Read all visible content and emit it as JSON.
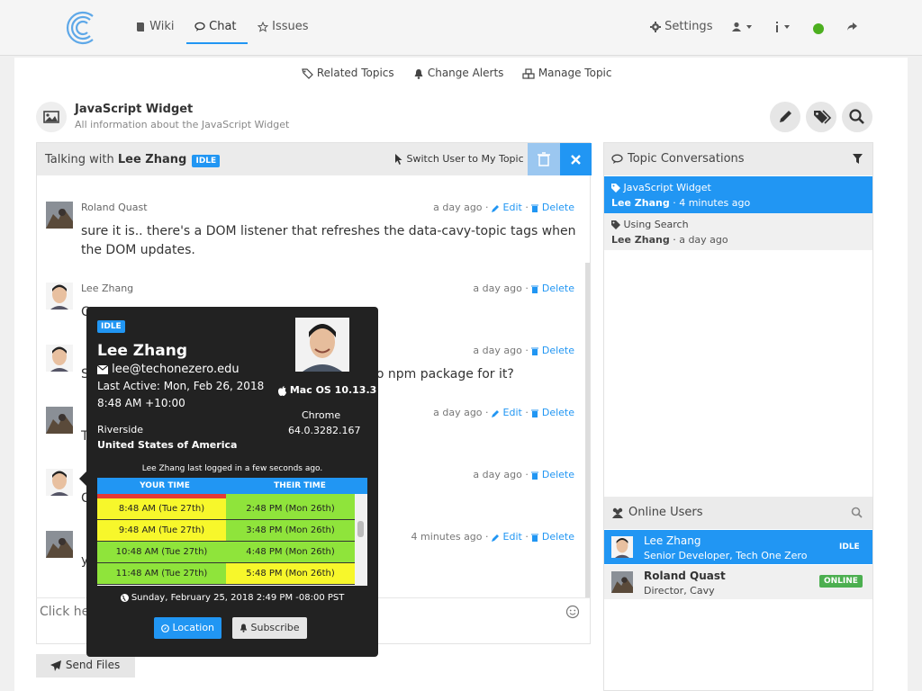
{
  "nav": {
    "wiki": "Wiki",
    "chat": "Chat",
    "issues": "Issues",
    "settings": "Settings"
  },
  "subnav": {
    "related_topics": "Related Topics",
    "change_alerts": "Change Alerts",
    "manage_topic": "Manage Topic"
  },
  "topic": {
    "title": "JavaScript Widget",
    "subtitle": "All information about the JavaScript Widget"
  },
  "chat": {
    "talking_prefix": "Talking with",
    "talking_user": "Lee Zhang",
    "status": "IDLE",
    "switch_label": "Switch User to My Topic",
    "composer_placeholder": "Click here to chat...",
    "send_files": "Send Files",
    "edit_label": "Edit",
    "delete_label": "Delete",
    "messages": [
      {
        "author": "Roland Quast",
        "time": "a day ago",
        "text": "sure it is.. there's a DOM listener that refreshes the data-cavy-topic tags when the DOM updates."
      },
      {
        "author": "Lee Zhang",
        "time": "a day ago",
        "text": "C"
      },
      {
        "author": "Lee Zhang",
        "time": "a day ago",
        "text": "S",
        "text_right": "no npm package for it?"
      },
      {
        "author": "Roland Quast",
        "time": "a day ago",
        "text": "T"
      },
      {
        "author": "Lee Zhang",
        "time": "a day ago",
        "text": "C"
      },
      {
        "author": "Roland Quast",
        "time": "4 minutes ago",
        "text": "y"
      }
    ]
  },
  "conversations": {
    "title": "Topic Conversations",
    "items": [
      {
        "topic": "JavaScript Widget",
        "user": "Lee Zhang",
        "time": "4 minutes ago"
      },
      {
        "topic": "Using Search",
        "user": "Lee Zhang",
        "time": "a day ago"
      }
    ]
  },
  "online": {
    "title": "Online Users",
    "users": [
      {
        "name": "Lee Zhang",
        "role": "Senior Developer, Tech One Zero",
        "status": "IDLE"
      },
      {
        "name": "Roland Quast",
        "role": "Director, Cavy",
        "status": "ONLINE"
      }
    ]
  },
  "profile": {
    "status": "IDLE",
    "name": "Lee Zhang",
    "email": "lee@techonezero.edu",
    "last_active_1": "Last Active: Mon, Feb 26, 2018",
    "last_active_2": "8:48 AM +10:00",
    "os": "Mac OS 10.13.3",
    "browser": "Chrome",
    "browser_version": "64.0.3282.167",
    "city": "Riverside",
    "country": "United States of America",
    "login_note": "Lee Zhang last logged in a few seconds ago.",
    "your_time_label": "YOUR TIME",
    "their_time_label": "THEIR TIME",
    "times": [
      {
        "yours": "8:48 AM (Tue 27th)",
        "theirs": "2:48 PM (Mon 26th)"
      },
      {
        "yours": "9:48 AM (Tue 27th)",
        "theirs": "3:48 PM (Mon 26th)"
      },
      {
        "yours": "10:48 AM (Tue 27th)",
        "theirs": "4:48 PM (Mon 26th)"
      },
      {
        "yours": "11:48 AM (Tue 27th)",
        "theirs": "5:48 PM (Mon 26th)"
      }
    ],
    "current_time": "Sunday, February 25, 2018 2:49 PM -08:00 PST",
    "location_btn": "Location",
    "subscribe_btn": "Subscribe"
  },
  "colors": {
    "accent": "#2196f3",
    "online": "#4caf50",
    "status_dot": "#4caf1f",
    "tz_yellow": "#f7f72b",
    "tz_green": "#8fe43b",
    "tz_red": "#e53935"
  }
}
